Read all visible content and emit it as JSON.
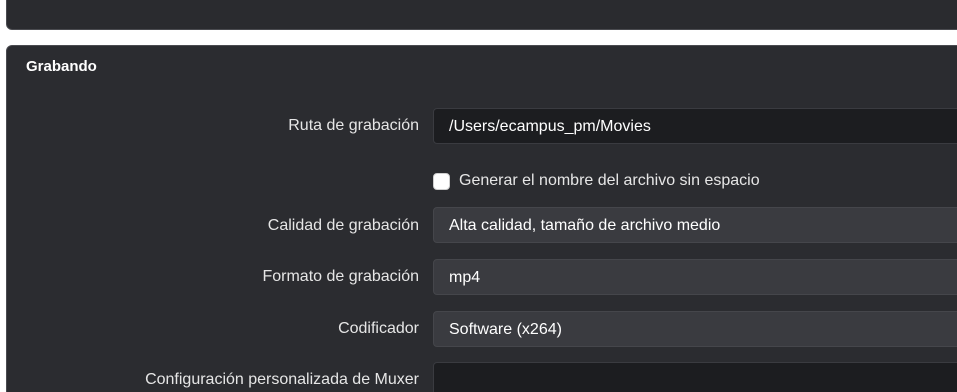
{
  "group": {
    "title": "Grabando"
  },
  "rows": {
    "path": {
      "label": "Ruta de grabación",
      "value": "/Users/ecampus_pm/Movies"
    },
    "no_space": {
      "label": "Generar el nombre del archivo sin espacio",
      "checked": false
    },
    "quality": {
      "label": "Calidad de grabación",
      "value": "Alta calidad, tamaño de archivo medio"
    },
    "format": {
      "label": "Formato de grabación",
      "value": "mp4"
    },
    "encoder": {
      "label": "Codificador",
      "value": "Software (x264)"
    },
    "muxer": {
      "label": "Configuración personalizada de Muxer",
      "value": ""
    }
  },
  "colors": {
    "panel_background": "#2b2c30",
    "input_background": "#1c1d20",
    "dropdown_background": "#3a3b40",
    "text": "#e6e6e6"
  }
}
